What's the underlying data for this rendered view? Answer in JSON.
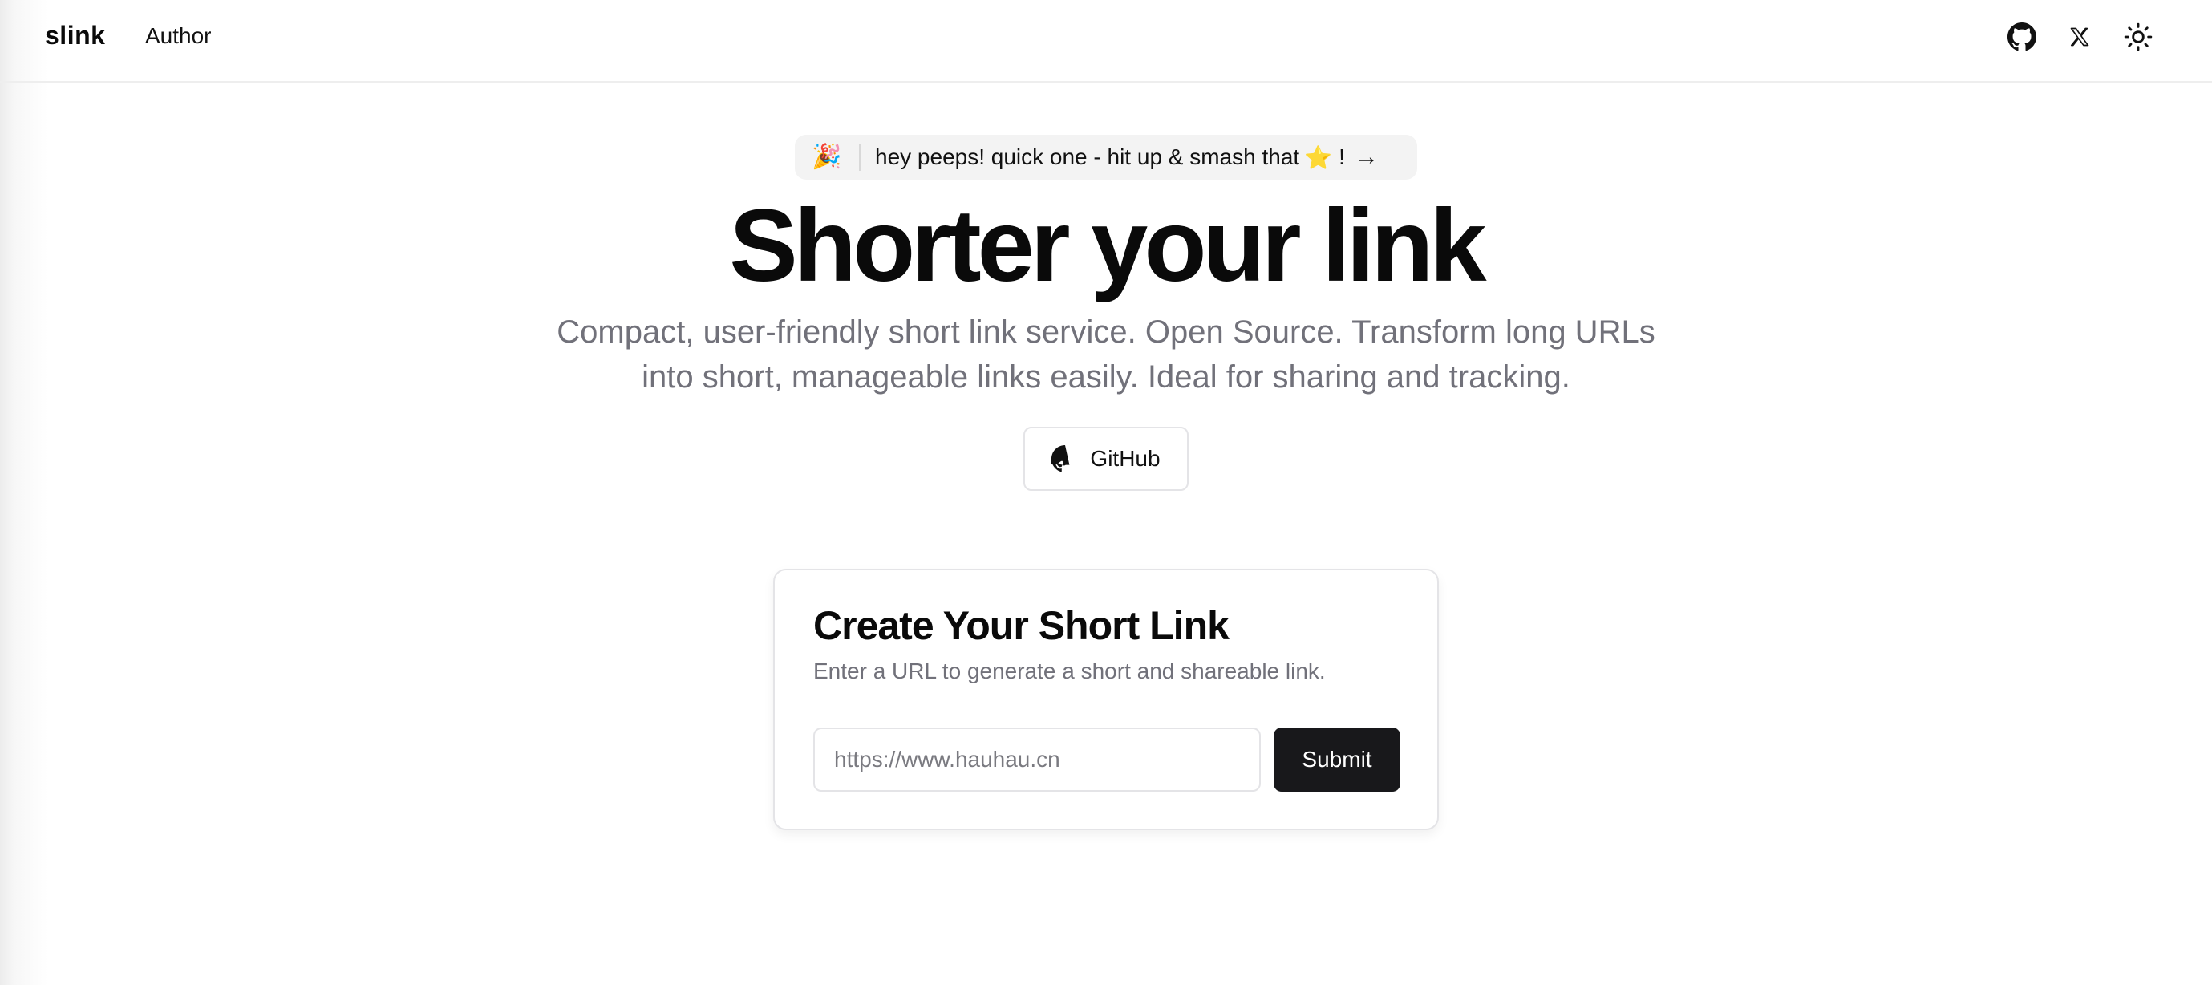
{
  "header": {
    "brand": "slink",
    "nav_author": "Author",
    "icons": [
      "github-icon",
      "x-logo-icon",
      "sun-icon"
    ]
  },
  "announcement": {
    "emoji": "🎉",
    "text": "hey peeps! quick one - hit up & smash that",
    "star": "⭐",
    "suffix": "!",
    "arrow": "→"
  },
  "hero": {
    "title": "Shorter your link",
    "subtitle": "Compact, user-friendly short link service. Open Source. Transform long URLs into short, manageable links easily. Ideal for sharing and tracking.",
    "github_button": "GitHub"
  },
  "card": {
    "title": "Create Your Short Link",
    "description": "Enter a URL to generate a short and shareable link.",
    "input_value": "",
    "input_placeholder": "https://www.hauhau.cn",
    "submit_label": "Submit"
  },
  "colors": {
    "text_primary": "#0a0a0a",
    "text_muted": "#71717a",
    "border": "#e4e4e7",
    "pill_bg": "#f3f3f3",
    "button_dark": "#18181b"
  }
}
